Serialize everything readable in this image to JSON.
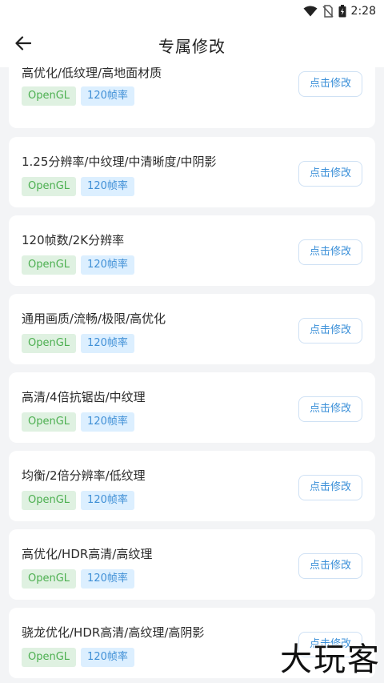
{
  "status": {
    "time": "2:28"
  },
  "header": {
    "title": "专属修改"
  },
  "cards": [
    {
      "title": "高优化/低纹理/高地面材质",
      "api": "OpenGL",
      "fps": "120帧率",
      "button": "点击修改"
    },
    {
      "title": "1.25分辨率/中纹理/中清晰度/中阴影",
      "api": "OpenGL",
      "fps": "120帧率",
      "button": "点击修改"
    },
    {
      "title": "120帧数/2K分辨率",
      "api": "OpenGL",
      "fps": "120帧率",
      "button": "点击修改"
    },
    {
      "title": "通用画质/流畅/极限/高优化",
      "api": "OpenGL",
      "fps": "120帧率",
      "button": "点击修改"
    },
    {
      "title": "高清/4倍抗锯齿/中纹理",
      "api": "OpenGL",
      "fps": "120帧率",
      "button": "点击修改"
    },
    {
      "title": "均衡/2倍分辨率/低纹理",
      "api": "OpenGL",
      "fps": "120帧率",
      "button": "点击修改"
    },
    {
      "title": "高优化/HDR高清/高纹理",
      "api": "OpenGL",
      "fps": "120帧率",
      "button": "点击修改"
    },
    {
      "title": "骁龙优化/HDR高清/高纹理/高阴影",
      "api": "OpenGL",
      "fps": "120帧率",
      "button": "点击修改"
    }
  ],
  "watermark": "大玩客",
  "icons": [
    "wifi-icon",
    "no-sim-icon",
    "battery-icon",
    "back-arrow-icon"
  ]
}
